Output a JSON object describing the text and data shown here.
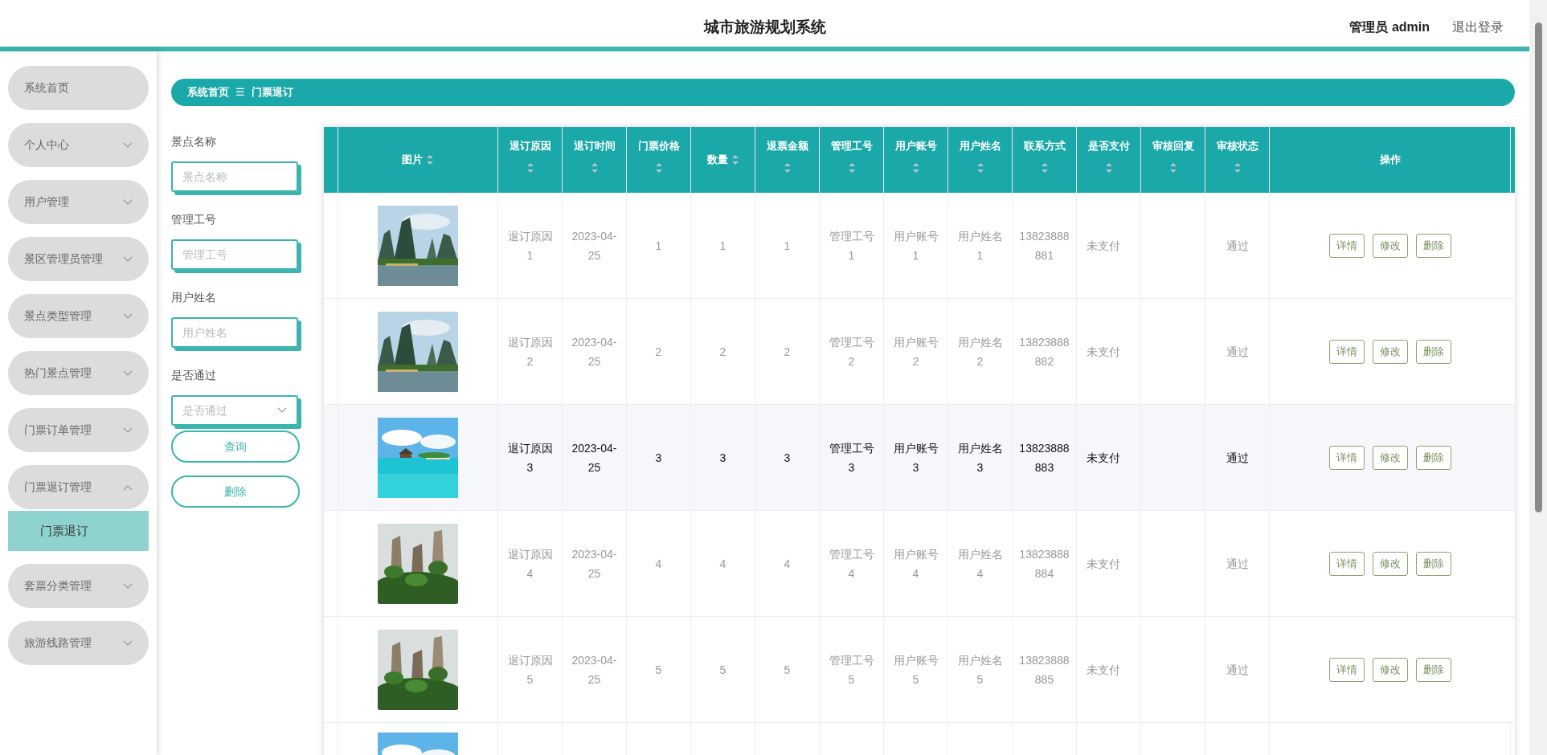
{
  "header": {
    "title": "城市旅游规划系统",
    "user": "管理员 admin",
    "logout": "退出登录"
  },
  "sidebar": {
    "items": [
      {
        "label": "系统首页",
        "kind": "link"
      },
      {
        "label": "个人中心",
        "kind": "group",
        "expanded": false
      },
      {
        "label": "用户管理",
        "kind": "group",
        "expanded": false
      },
      {
        "label": "景区管理员管理",
        "kind": "group",
        "expanded": false
      },
      {
        "label": "景点类型管理",
        "kind": "group",
        "expanded": false
      },
      {
        "label": "热门景点管理",
        "kind": "group",
        "expanded": false
      },
      {
        "label": "门票订单管理",
        "kind": "group",
        "expanded": false
      },
      {
        "label": "门票退订管理",
        "kind": "group",
        "expanded": true,
        "children": [
          {
            "label": "门票退订",
            "selected": true
          }
        ]
      },
      {
        "label": "套票分类管理",
        "kind": "group",
        "expanded": false
      },
      {
        "label": "旅游线路管理",
        "kind": "group",
        "expanded": false
      }
    ]
  },
  "breadcrumb": {
    "items": [
      "系统首页",
      "门票退订"
    ],
    "separator": "☰"
  },
  "filters": [
    {
      "kind": "input",
      "label": "景点名称",
      "placeholder": "景点名称"
    },
    {
      "kind": "input",
      "label": "管理工号",
      "placeholder": "管理工号"
    },
    {
      "kind": "input",
      "label": "用户姓名",
      "placeholder": "用户姓名"
    },
    {
      "kind": "select",
      "label": "是否通过",
      "placeholder": "是否通过"
    }
  ],
  "filter_buttons": [
    "查询",
    "删除"
  ],
  "table": {
    "columns": [
      {
        "kind": "plain"
      },
      {
        "label": "图片",
        "kind": "sort-inline"
      },
      {
        "label": "退订原因",
        "kind": "sort-below"
      },
      {
        "label": "退订时间",
        "kind": "sort-below"
      },
      {
        "label": "门票价格",
        "kind": "sort-below"
      },
      {
        "label": "数量",
        "kind": "sort-inline"
      },
      {
        "label": "退票金额",
        "kind": "sort-below"
      },
      {
        "label": "管理工号",
        "kind": "sort-below"
      },
      {
        "label": "用户账号",
        "kind": "sort-below"
      },
      {
        "label": "用户姓名",
        "kind": "sort-below"
      },
      {
        "label": "联系方式",
        "kind": "sort-below"
      },
      {
        "label": "是否支付",
        "kind": "sort-below"
      },
      {
        "label": "审核回复",
        "kind": "sort-below"
      },
      {
        "label": "审核状态",
        "kind": "sort-below"
      },
      {
        "label": "操作",
        "kind": "plain"
      }
    ],
    "rows": [
      {
        "kind": "full",
        "highlighted": false,
        "cells": [
          "退订原因1",
          "2023-04-25",
          "1",
          "1",
          "1",
          "管理工号1",
          "用户账号1",
          "用户姓名1",
          "13823888881",
          "未支付",
          "",
          "通过"
        ],
        "actions": [
          "详情",
          "修改",
          "删除"
        ]
      },
      {
        "kind": "full",
        "highlighted": false,
        "cells": [
          "退订原因2",
          "2023-04-25",
          "2",
          "2",
          "2",
          "管理工号2",
          "用户账号2",
          "用户姓名2",
          "13823888882",
          "未支付",
          "",
          "通过"
        ],
        "actions": [
          "详情",
          "修改",
          "删除"
        ]
      },
      {
        "kind": "full",
        "highlighted": true,
        "cells": [
          "退订原因3",
          "2023-04-25",
          "3",
          "3",
          "3",
          "管理工号3",
          "用户账号3",
          "用户姓名3",
          "13823888883",
          "未支付",
          "",
          "通过"
        ],
        "actions": [
          "详情",
          "修改",
          "删除"
        ]
      },
      {
        "kind": "full",
        "highlighted": false,
        "cells": [
          "退订原因4",
          "2023-04-25",
          "4",
          "4",
          "4",
          "管理工号4",
          "用户账号4",
          "用户姓名4",
          "13823888884",
          "未支付",
          "",
          "通过"
        ],
        "actions": [
          "详情",
          "修改",
          "删除"
        ]
      },
      {
        "kind": "full",
        "highlighted": false,
        "cells": [
          "退订原因5",
          "2023-04-25",
          "5",
          "5",
          "5",
          "管理工号5",
          "用户账号5",
          "用户姓名5",
          "13823888885",
          "未支付",
          "",
          "通过"
        ],
        "actions": [
          "详情",
          "修改",
          "删除"
        ]
      },
      {
        "kind": "cut"
      }
    ]
  }
}
